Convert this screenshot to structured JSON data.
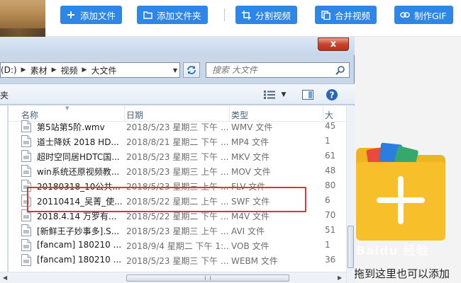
{
  "toolbar": {
    "buttons": [
      {
        "label": "添加文件",
        "icon": "plus-icon"
      },
      {
        "label": "添加文件夹",
        "icon": "folder-icon"
      },
      {
        "label": "分割视频",
        "icon": "crop-icon"
      },
      {
        "label": "合并视频",
        "icon": "copy-icon"
      },
      {
        "label": "制作GIF",
        "icon": "link-icon"
      }
    ],
    "accent": "#2e86e6"
  },
  "dialog": {
    "close_label": "x",
    "breadcrumb": [
      "(D:)",
      "素材",
      "视频",
      "大文件"
    ],
    "search_placeholder": "搜索 大文件",
    "left_cmd_fragment": "夹"
  },
  "columns": {
    "name": "名称",
    "date": "日期",
    "type": "类型",
    "size": "大"
  },
  "files": [
    {
      "name": "第5站第5阶.wmv",
      "date": "2018/5/23 星期三 下午 ...",
      "type": "WMV 文件",
      "size": "45"
    },
    {
      "name": "道士降妖 2018 HD...",
      "date": "2018/8/21 星期二 下午 ...",
      "type": "MP4 文件",
      "size": "1"
    },
    {
      "name": "超时空同居HDTC国...",
      "date": "2018/5/23 星期三 下午 ...",
      "type": "MKV 文件",
      "size": "61"
    },
    {
      "name": "win系统还原视频教...",
      "date": "2018/5/23 星期三 上午 ...",
      "type": "MOV 文件",
      "size": "48"
    },
    {
      "name": "20180318_10公共...",
      "date": "2018/5/23 星期三 上午 ...",
      "type": "FLV 文件",
      "size": "80"
    },
    {
      "name": "20110414_吴菁_使...",
      "date": "2018/5/22 星期二 上午 ...",
      "type": "SWF 文件",
      "size": "6"
    },
    {
      "name": "2018.4.14 万罗有...",
      "date": "2018/5/22 星期二 下午 ...",
      "type": "M4V 文件",
      "size": "70"
    },
    {
      "name": "[新鲜王子妙事多].S...",
      "date": "2018/5/23 星期三 上午 ...",
      "type": "AVI 文件",
      "size": "51"
    },
    {
      "name": "[fancam] 180210 ...",
      "date": "2018/9/4 星期二 下午 1:...",
      "type": "VOB 文件",
      "size": "1"
    },
    {
      "name": "[fancam] 180210 ...",
      "date": "2018/5/23 星期三 下午 ...",
      "type": "WEBM 文件",
      "size": "36"
    }
  ],
  "hint_text": "拖到这里也可以添加",
  "watermark": "Baidu 经验",
  "colors": {
    "highlight": "#d9363a",
    "folder": "#f7c02b",
    "folder_plus": "#ffffff"
  }
}
